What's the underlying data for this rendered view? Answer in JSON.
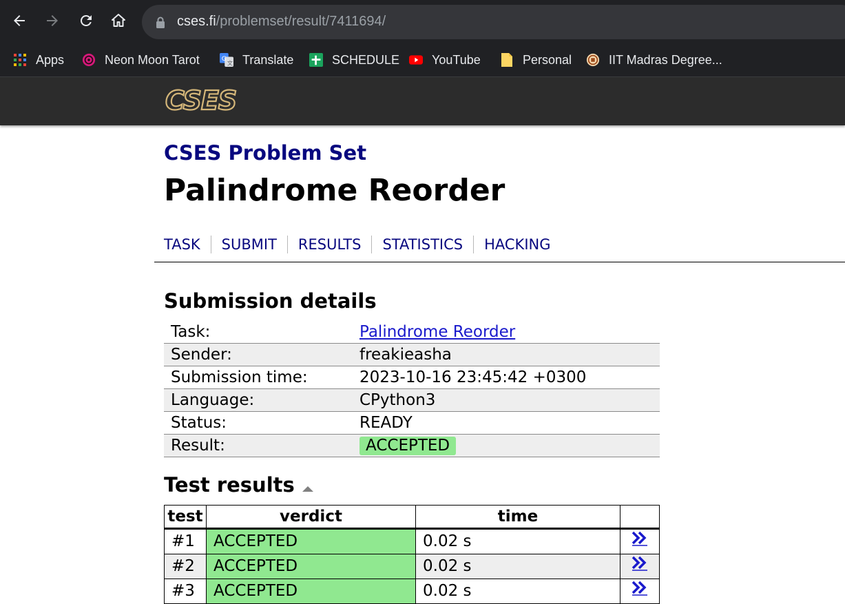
{
  "browser": {
    "url_host": "cses.fi",
    "url_path": "/problemset/result/7411694/",
    "bookmarks": [
      {
        "label": "Apps",
        "icon": "apps-grid-icon"
      },
      {
        "label": "Neon Moon Tarot",
        "icon": "neon-moon-tarot-icon"
      },
      {
        "label": "Translate",
        "icon": "translate-icon"
      },
      {
        "label": "SCHEDULE",
        "icon": "sheets-icon"
      },
      {
        "label": "YouTube",
        "icon": "youtube-icon"
      },
      {
        "label": "Personal",
        "icon": "folder-icon"
      },
      {
        "label": "IIT Madras Degree...",
        "icon": "iit-madras-icon"
      }
    ]
  },
  "site": {
    "logo_text": "CSES",
    "subtitle": "CSES Problem Set",
    "title": "Palindrome Reorder",
    "tabs": [
      "TASK",
      "SUBMIT",
      "RESULTS",
      "STATISTICS",
      "HACKING"
    ]
  },
  "submission": {
    "heading": "Submission details",
    "rows": [
      {
        "key": "Task:",
        "value": "Palindrome Reorder"
      },
      {
        "key": "Sender:",
        "value": "freakieasha"
      },
      {
        "key": "Submission time:",
        "value": "2023-10-16 23:45:42 +0300"
      },
      {
        "key": "Language:",
        "value": "CPython3"
      },
      {
        "key": "Status:",
        "value": "READY"
      },
      {
        "key": "Result:",
        "value": "ACCEPTED"
      }
    ]
  },
  "tests": {
    "heading": "Test results",
    "columns": [
      "test",
      "verdict",
      "time"
    ],
    "rows": [
      {
        "test": "#1",
        "verdict": "ACCEPTED",
        "time": "0.02 s"
      },
      {
        "test": "#2",
        "verdict": "ACCEPTED",
        "time": "0.02 s"
      },
      {
        "test": "#3",
        "verdict": "ACCEPTED",
        "time": "0.02 s"
      }
    ]
  },
  "colors": {
    "accent_navy": "#08087f",
    "accepted_green": "#90e890",
    "header_dark": "#2c2c2c"
  }
}
